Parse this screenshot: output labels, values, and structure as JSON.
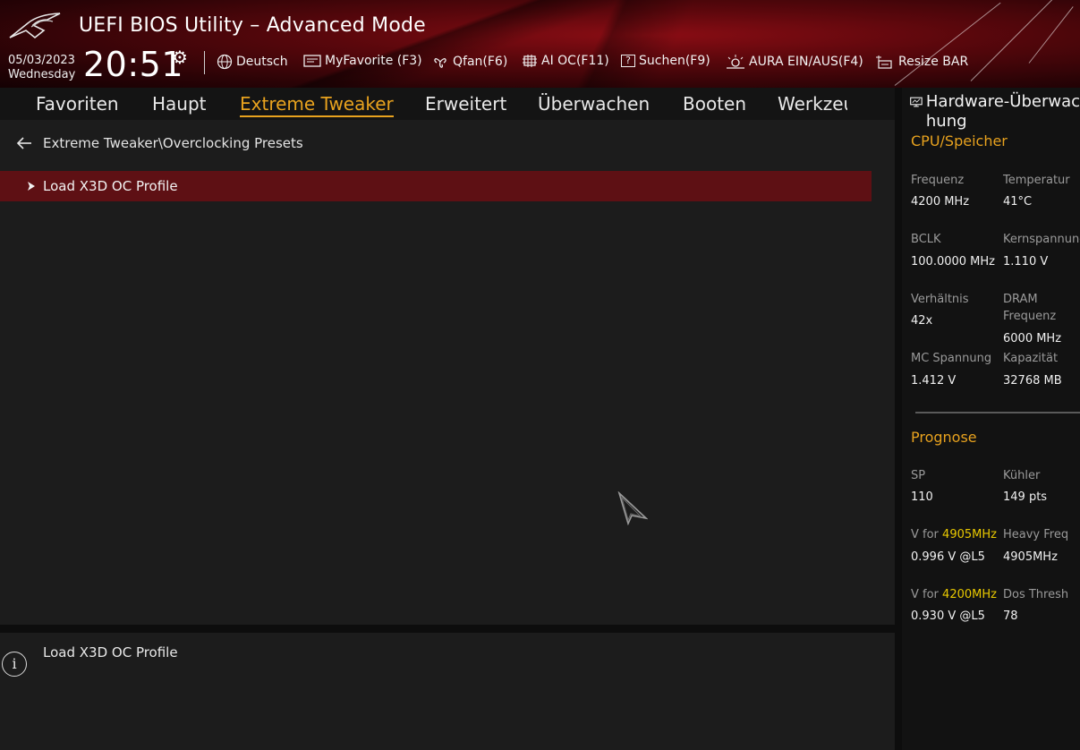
{
  "header": {
    "title": "UEFI BIOS Utility – Advanced Mode",
    "date": "05/03/2023",
    "weekday": "Wednesday",
    "time": "20:51"
  },
  "toolbar": {
    "language": "Deutsch",
    "myfavorite": "MyFavorite (F3)",
    "qfan": "Qfan(F6)",
    "aioc": "AI OC(F11)",
    "search": "Suchen(F9)",
    "aura": "AURA EIN/AUS(F4)",
    "resizebar": "Resize BAR"
  },
  "tabs": [
    {
      "label": "Favoriten"
    },
    {
      "label": "Haupt"
    },
    {
      "label": "Extreme Tweaker"
    },
    {
      "label": "Erweitert"
    },
    {
      "label": "Überwachen"
    },
    {
      "label": "Booten"
    },
    {
      "label": "Werkzeu"
    }
  ],
  "active_tab": "Extreme Tweaker",
  "breadcrumb": "Extreme Tweaker\\Overclocking Presets",
  "menu_items": [
    {
      "label": "Load X3D OC Profile",
      "selected": true
    }
  ],
  "help": {
    "text": "Load X3D OC Profile"
  },
  "monitor": {
    "title": "Hardware-Überwac\nhung",
    "cpu_section": "CPU/Speicher",
    "cpu": {
      "freq_label": "Frequenz",
      "freq_value": "4200 MHz",
      "temp_label": "Temperatur",
      "temp_value": "41°C",
      "bclk_label": "BCLK",
      "bclk_value": "100.0000 MHz",
      "core_label": "Kernspannung",
      "core_value": "1.110 V",
      "ratio_label": "Verhältnis",
      "ratio_value": "42x",
      "dram_label_1": "DRAM",
      "dram_label_2": "Frequenz",
      "dram_value": "6000 MHz",
      "mc_label": "MC Spannung",
      "mc_value": "1.412 V",
      "cap_label": "Kapazität",
      "cap_value": "32768 MB"
    },
    "prognose_section": "Prognose",
    "prognose": {
      "sp_label": "SP",
      "sp_value": "110",
      "cooler_label": "Kühler",
      "cooler_value": "149 pts",
      "vfor1_prefix": "V for ",
      "vfor1_freq": "4905MHz",
      "vfor1_value": "0.996 V @L5",
      "heavy_label": "Heavy Freq",
      "heavy_value": "4905MHz",
      "vfor2_prefix": "V for ",
      "vfor2_freq": "4200MHz",
      "vfor2_value": "0.930 V @L5",
      "dos_label": "Dos Thresh",
      "dos_value": "78"
    }
  },
  "colors": {
    "accent": "#e8a21e",
    "highlight": "#e8c800",
    "selected_row": "#5e1014",
    "header_red": "#8a0d14"
  },
  "icons": [
    "rog-logo-icon",
    "gear-icon",
    "globe-icon",
    "myfavorite-icon",
    "fan-icon",
    "ai-oc-icon",
    "search-help-icon",
    "aura-icon",
    "resize-bar-icon",
    "back-arrow-icon",
    "chevron-right-icon",
    "info-icon",
    "monitor-icon",
    "mouse-pointer-icon"
  ]
}
